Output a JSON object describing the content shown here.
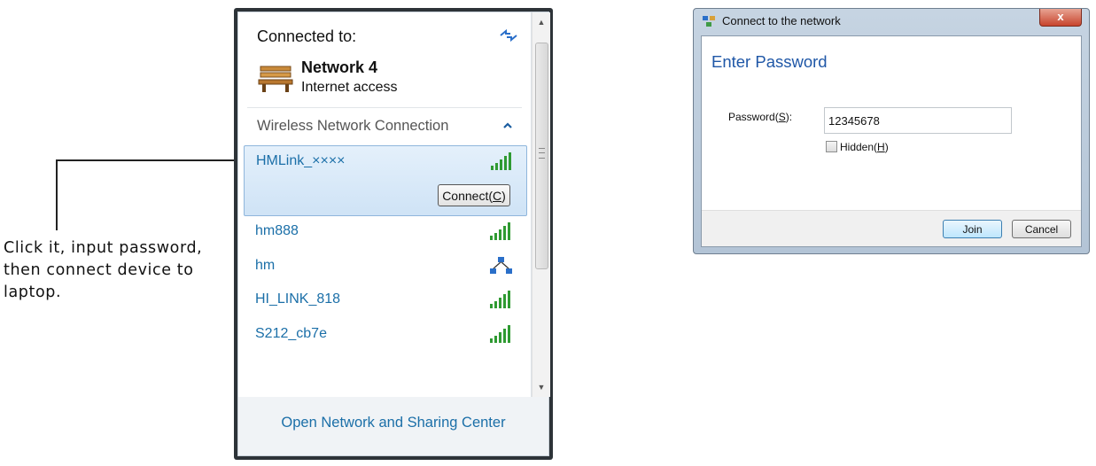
{
  "instruction": {
    "line1": "Click it, input password,",
    "line2": "then connect device to",
    "line3": "laptop."
  },
  "flyout": {
    "connected_label": "Connected to:",
    "current_network": {
      "name": "Network 4",
      "status": "Internet access"
    },
    "section_title": "Wireless Network Connection",
    "networks": [
      {
        "ssid": "HMLink_××××",
        "selected": true,
        "icon": "wifi-signal-icon"
      },
      {
        "ssid": "hm888",
        "icon": "wifi-signal-icon"
      },
      {
        "ssid": "hm",
        "icon": "adhoc-network-icon"
      },
      {
        "ssid": "HI_LINK_818",
        "icon": "wifi-signal-icon"
      },
      {
        "ssid": "S212_cb7e",
        "icon": "wifi-signal-icon"
      }
    ],
    "connect_button": {
      "text": "Connect(",
      "accel": "C",
      "after": ")"
    },
    "footer_link": "Open Network and Sharing Center"
  },
  "dialog": {
    "title": "Connect to the network",
    "close_label": "x",
    "heading": "Enter Password",
    "password": {
      "label_pre": "Password(",
      "accel": "S",
      "label_post": "):",
      "value": "12345678"
    },
    "hidden": {
      "label_pre": "Hidden(",
      "accel": "H",
      "label_post": ")",
      "checked": false
    },
    "join_label": "Join",
    "cancel_label": "Cancel"
  },
  "colors": {
    "link_blue": "#1b6fa8",
    "heading_blue": "#1f57a7",
    "signal_green": "#2f9a32"
  }
}
